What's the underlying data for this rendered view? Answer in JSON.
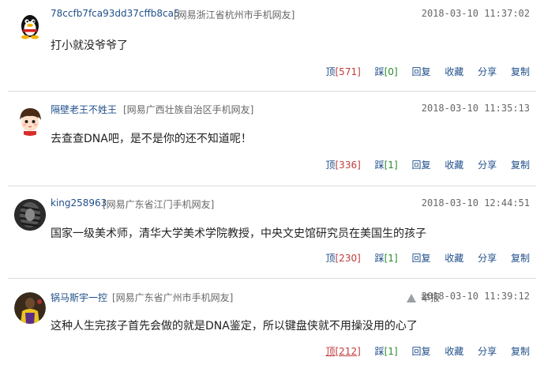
{
  "comments": [
    {
      "user": "78ccfb7fca93dd37cffb8ca5",
      "location": "[网易浙江省杭州市手机网友]",
      "time": "2018-03-10 11:37:02",
      "text": "打小就没爷爷了",
      "up_label": "顶",
      "up_count": "[571]",
      "down_label": "踩",
      "down_count": "[0]",
      "reply": "回复",
      "fav": "收藏",
      "share": "分享",
      "copy": "复制",
      "avatar_icon": "qq-penguin-icon"
    },
    {
      "user": "隔壁老王不姓王",
      "location": "[网易广西壮族自治区手机网友]",
      "time": "2018-03-10 11:35:13",
      "text": "去查查DNA吧，是不是你的还不知道呢！",
      "up_label": "顶",
      "up_count": "[336]",
      "down_label": "踩",
      "down_count": "[1]",
      "reply": "回复",
      "fav": "收藏",
      "share": "分享",
      "copy": "复制",
      "avatar_icon": "cartoon-boy-avatar"
    },
    {
      "user": "king258963",
      "location": "[网易广东省江门手机网友]",
      "time": "2018-03-10 12:44:51",
      "text": "国家一级美术师，清华大学美术学院教授，中央文史馆研究员在美国生的孩子",
      "up_label": "顶",
      "up_count": "[230]",
      "down_label": "踩",
      "down_count": "[1]",
      "reply": "回复",
      "fav": "收藏",
      "share": "分享",
      "copy": "复制",
      "avatar_icon": "dark-striped-avatar"
    },
    {
      "user": "锅马斯宇一控",
      "location": "[网易广东省广州市手机网友]",
      "time": "2018-03-10 11:39:12",
      "report": "举报",
      "text": "这种人生完孩子首先会做的就是DNA鉴定，所以键盘侠就不用操没用的心了",
      "up_label": "顶",
      "up_count": "[212]",
      "down_label": "踩",
      "down_count": "[1]",
      "reply": "回复",
      "fav": "收藏",
      "share": "分享",
      "copy": "复制",
      "avatar_icon": "basketball-player-avatar"
    }
  ]
}
